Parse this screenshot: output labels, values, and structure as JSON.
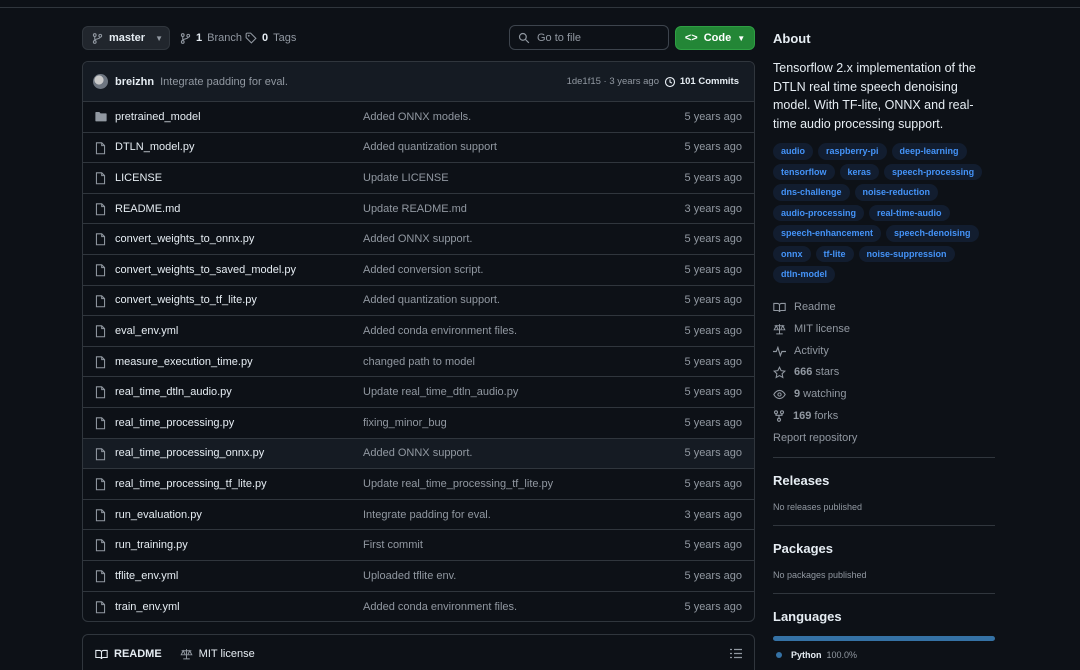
{
  "toolbar": {
    "branch": "master",
    "branches_count": "1",
    "branches_label": "Branch",
    "tags_count": "0",
    "tags_label": "Tags",
    "search_placeholder": "Go to file",
    "code_label": "Code"
  },
  "commit": {
    "author": "breizhn",
    "message": "Integrate padding for eval.",
    "hash_time": "1de1f15 · 3 years ago",
    "commits_label": "101 Commits"
  },
  "files": [
    {
      "name": "pretrained_model",
      "type": "folder",
      "message": "Added ONNX models.",
      "date": "5 years ago"
    },
    {
      "name": "DTLN_model.py",
      "type": "file",
      "message": "Added quantization support",
      "date": "5 years ago"
    },
    {
      "name": "LICENSE",
      "type": "file",
      "message": "Update LICENSE",
      "date": "5 years ago"
    },
    {
      "name": "README.md",
      "type": "file",
      "message": "Update README.md",
      "date": "3 years ago"
    },
    {
      "name": "convert_weights_to_onnx.py",
      "type": "file",
      "message": "Added ONNX support.",
      "date": "5 years ago"
    },
    {
      "name": "convert_weights_to_saved_model.py",
      "type": "file",
      "message": "Added conversion script.",
      "date": "5 years ago"
    },
    {
      "name": "convert_weights_to_tf_lite.py",
      "type": "file",
      "message": "Added quantization support.",
      "date": "5 years ago"
    },
    {
      "name": "eval_env.yml",
      "type": "file",
      "message": "Added conda environment files.",
      "date": "5 years ago"
    },
    {
      "name": "measure_execution_time.py",
      "type": "file",
      "message": "changed path to model",
      "date": "5 years ago"
    },
    {
      "name": "real_time_dtln_audio.py",
      "type": "file",
      "message": "Update real_time_dtln_audio.py",
      "date": "5 years ago"
    },
    {
      "name": "real_time_processing.py",
      "type": "file",
      "message": "fixing_minor_bug",
      "date": "5 years ago"
    },
    {
      "name": "real_time_processing_onnx.py",
      "type": "file",
      "message": "Added ONNX support.",
      "date": "5 years ago"
    },
    {
      "name": "real_time_processing_tf_lite.py",
      "type": "file",
      "message": "Update real_time_processing_tf_lite.py",
      "date": "5 years ago"
    },
    {
      "name": "run_evaluation.py",
      "type": "file",
      "message": "Integrate padding for eval.",
      "date": "3 years ago"
    },
    {
      "name": "run_training.py",
      "type": "file",
      "message": "First commit",
      "date": "5 years ago"
    },
    {
      "name": "tflite_env.yml",
      "type": "file",
      "message": "Uploaded tflite env.",
      "date": "5 years ago"
    },
    {
      "name": "train_env.yml",
      "type": "file",
      "message": "Added conda environment files.",
      "date": "5 years ago"
    }
  ],
  "readme_tabs": {
    "readme": "README",
    "license": "MIT license"
  },
  "about": {
    "heading": "About",
    "description": "Tensorflow 2.x implementation of the DTLN real time speech denoising model. With TF-lite, ONNX and real-time audio processing support.",
    "topics": [
      "audio",
      "raspberry-pi",
      "deep-learning",
      "tensorflow",
      "keras",
      "speech-processing",
      "dns-challenge",
      "noise-reduction",
      "audio-processing",
      "real-time-audio",
      "speech-enhancement",
      "speech-denoising",
      "onnx",
      "tf-lite",
      "noise-suppression",
      "dtln-model"
    ],
    "readme": "Readme",
    "license": "MIT license",
    "activity": "Activity",
    "stars_count": "666",
    "stars_label": "stars",
    "watching_count": "9",
    "watching_label": "watching",
    "forks_count": "169",
    "forks_label": "forks",
    "report": "Report repository"
  },
  "releases": {
    "heading": "Releases",
    "text": "No releases published"
  },
  "packages": {
    "heading": "Packages",
    "text": "No packages published"
  },
  "languages": {
    "heading": "Languages",
    "name": "Python",
    "percent": "100.0%",
    "share": 1.0,
    "color": "#3572a5"
  }
}
